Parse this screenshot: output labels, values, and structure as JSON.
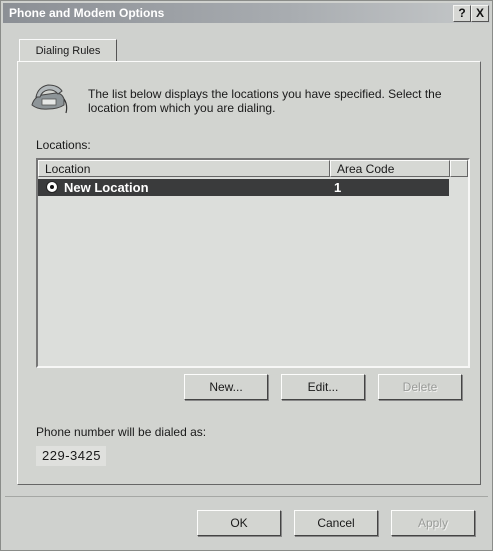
{
  "window": {
    "title": "Phone and Modem Options",
    "help_glyph": "?",
    "close_glyph": "X"
  },
  "tabs": [
    {
      "label": "Dialing Rules",
      "selected": true
    }
  ],
  "panel": {
    "description": "The list below displays the locations you have specified. Select the location from which you are dialing.",
    "locations_label": "Locations:",
    "columns": {
      "location": "Location",
      "area_code": "Area Code"
    },
    "rows": [
      {
        "location": "New Location",
        "area_code": "1",
        "selected": true
      }
    ],
    "buttons": {
      "new": "New...",
      "edit": "Edit...",
      "delete": "Delete"
    },
    "dial_label": "Phone number will be dialed as:",
    "dial_number": "229-3425"
  },
  "footer": {
    "ok": "OK",
    "cancel": "Cancel",
    "apply": "Apply"
  },
  "icons": {
    "phone": "telephone-icon",
    "radio": "radio-selected-icon"
  }
}
